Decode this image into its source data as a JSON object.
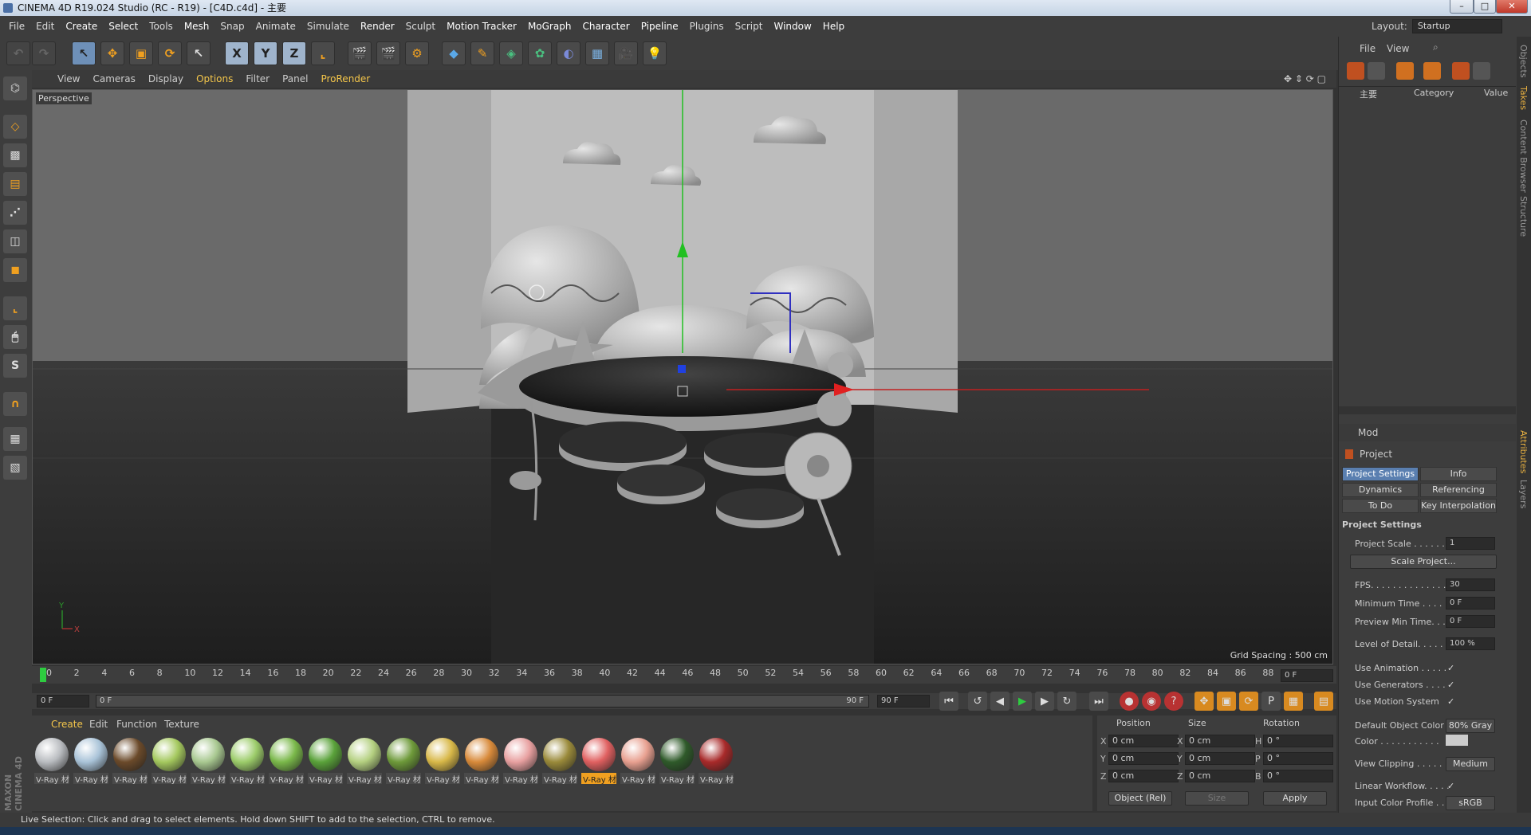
{
  "window": {
    "title": "CINEMA 4D R19.024 Studio (RC - R19) - [C4D.c4d] - 主要",
    "min": "–",
    "max": "□",
    "close": "✕"
  },
  "menubar": [
    "File",
    "Edit",
    "Create",
    "Select",
    "Tools",
    "Mesh",
    "Snap",
    "Animate",
    "Simulate",
    "Render",
    "Sculpt",
    "Motion Tracker",
    "MoGraph",
    "Character",
    "Pipeline",
    "Plugins",
    "Script",
    "Window",
    "Help"
  ],
  "layout": {
    "label": "Layout:",
    "value": "Startup"
  },
  "viewport": {
    "menu": [
      "View",
      "Cameras",
      "Display",
      "Options",
      "Filter",
      "Panel",
      "ProRender"
    ],
    "label": "Perspective",
    "grid_spacing": "Grid Spacing : 500 cm",
    "axis_y": "Y",
    "axis_x": "X"
  },
  "timeline": {
    "ticks": [
      "0",
      "2",
      "4",
      "6",
      "8",
      "10",
      "12",
      "14",
      "16",
      "18",
      "20",
      "22",
      "24",
      "26",
      "28",
      "30",
      "32",
      "34",
      "36",
      "38",
      "40",
      "42",
      "44",
      "46",
      "48",
      "50",
      "52",
      "54",
      "56",
      "58",
      "60",
      "62",
      "64",
      "66",
      "68",
      "70",
      "72",
      "74",
      "76",
      "78",
      "80",
      "82",
      "84",
      "86",
      "88",
      "90"
    ],
    "current_frame": "0 F",
    "start": "0 F",
    "range_start": "0 F",
    "range_end": "90 F",
    "end": "90 F"
  },
  "materials": {
    "tabs": [
      "Create",
      "Edit",
      "Function",
      "Texture"
    ],
    "items": [
      {
        "label": "V-Ray 材",
        "color": "#b9bcc0"
      },
      {
        "label": "V-Ray 材",
        "color": "#a9c3d8"
      },
      {
        "label": "V-Ray 材",
        "color": "#6b4a2a"
      },
      {
        "label": "V-Ray 材",
        "color": "#a4c85e"
      },
      {
        "label": "V-Ray 材",
        "color": "#a8c890"
      },
      {
        "label": "V-Ray 材",
        "color": "#9ccc6a"
      },
      {
        "label": "V-Ray 材",
        "color": "#7ab84a"
      },
      {
        "label": "V-Ray 材",
        "color": "#5aa23a"
      },
      {
        "label": "V-Ray 材",
        "color": "#b4d080"
      },
      {
        "label": "V-Ray 材",
        "color": "#6e9a3a"
      },
      {
        "label": "V-Ray 材",
        "color": "#d8b848"
      },
      {
        "label": "V-Ray 材",
        "color": "#d88a3a"
      },
      {
        "label": "V-Ray 材",
        "color": "#e8a0a0"
      },
      {
        "label": "V-Ray 材",
        "color": "#9a8a3a"
      },
      {
        "label": "V-Ray 材",
        "color": "#e06060",
        "selected": true
      },
      {
        "label": "V-Ray 材",
        "color": "#e8a090"
      },
      {
        "label": "V-Ray 材",
        "color": "#2f5a2a"
      },
      {
        "label": "V-Ray 材",
        "color": "#a82a2a"
      }
    ]
  },
  "coords": {
    "headers": [
      "Position",
      "Size",
      "Rotation"
    ],
    "rows": [
      {
        "axis": "X",
        "pos": "0 cm",
        "saxis": "X",
        "size": "0 cm",
        "raxis": "H",
        "rot": "0 °"
      },
      {
        "axis": "Y",
        "pos": "0 cm",
        "saxis": "Y",
        "size": "0 cm",
        "raxis": "P",
        "rot": "0 °"
      },
      {
        "axis": "Z",
        "pos": "0 cm",
        "saxis": "Z",
        "size": "0 cm",
        "raxis": "B",
        "rot": "0 °"
      }
    ],
    "mode": "Object (Rel)",
    "size_mode": "Size",
    "apply": "Apply"
  },
  "status": "Live Selection: Click and drag to select elements. Hold down SHIFT to add to the selection, CTRL to remove.",
  "objects_panel": {
    "menu": [
      "File",
      "View"
    ],
    "tree_item": "主要",
    "columns": [
      "Category",
      "Value"
    ]
  },
  "attributes": {
    "menu": "Mod",
    "object": "Project",
    "tabs": [
      "Project Settings",
      "Info",
      "Dynamics",
      "Referencing",
      "To Do",
      "Key Interpolation"
    ],
    "section": "Project Settings",
    "rows": [
      {
        "label": "Project Scale . . . . . .",
        "value": "1"
      },
      {
        "label": "FPS. . . . . . . . . . . . . .",
        "value": "30"
      },
      {
        "label": "Minimum Time . . . . .",
        "value": "0 F"
      },
      {
        "label": "Preview Min Time. . .",
        "value": "0 F"
      },
      {
        "label": "Level of Detail. . . . . .",
        "value": "100 %"
      }
    ],
    "scale_button": "Scale Project...",
    "checks": [
      "Use Animation . . . . .",
      "Use Generators . . . .",
      "Use Motion System"
    ],
    "check_mark": "✓",
    "default_color_label": "Default Object Color",
    "default_color_value": "80% Gray",
    "color_label": "Color . . . . . . . . . . .",
    "view_clipping_label": "View Clipping . . . . . .",
    "view_clipping_value": "Medium",
    "linear_label": "Linear Workflow. . . . .",
    "input_profile_label": "Input Color Profile . .",
    "input_profile_value": "sRGB"
  },
  "sidetabs": [
    "Objects",
    "Takes",
    "Content Browser",
    "Structure",
    "Attributes",
    "Layers"
  ],
  "brand": "MAXON CINEMA 4D"
}
